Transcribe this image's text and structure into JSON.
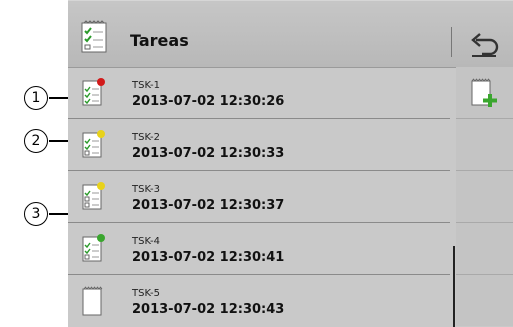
{
  "header": {
    "title": "Tareas",
    "icon": "task-list-icon",
    "back_icon": "back-arrow-icon"
  },
  "tasks": [
    {
      "id": "TSK-1",
      "datetime": "2013-07-02 12:30:26",
      "status_color": "#d21a1a"
    },
    {
      "id": "TSK-2",
      "datetime": "2013-07-02 12:30:33",
      "status_color": "#e8d21a"
    },
    {
      "id": "TSK-3",
      "datetime": "2013-07-02 12:30:37",
      "status_color": "#e8d21a"
    },
    {
      "id": "TSK-4",
      "datetime": "2013-07-02 12:30:41",
      "status_color": "#3aa62e"
    },
    {
      "id": "TSK-5",
      "datetime": "2013-07-02 12:30:43",
      "status_color": ""
    }
  ],
  "side": {
    "add_icon": "add-task-icon"
  },
  "callouts": [
    "1",
    "2",
    "3"
  ],
  "colors": {
    "panel": "#c9c9c9",
    "add_green": "#3aa62e"
  }
}
